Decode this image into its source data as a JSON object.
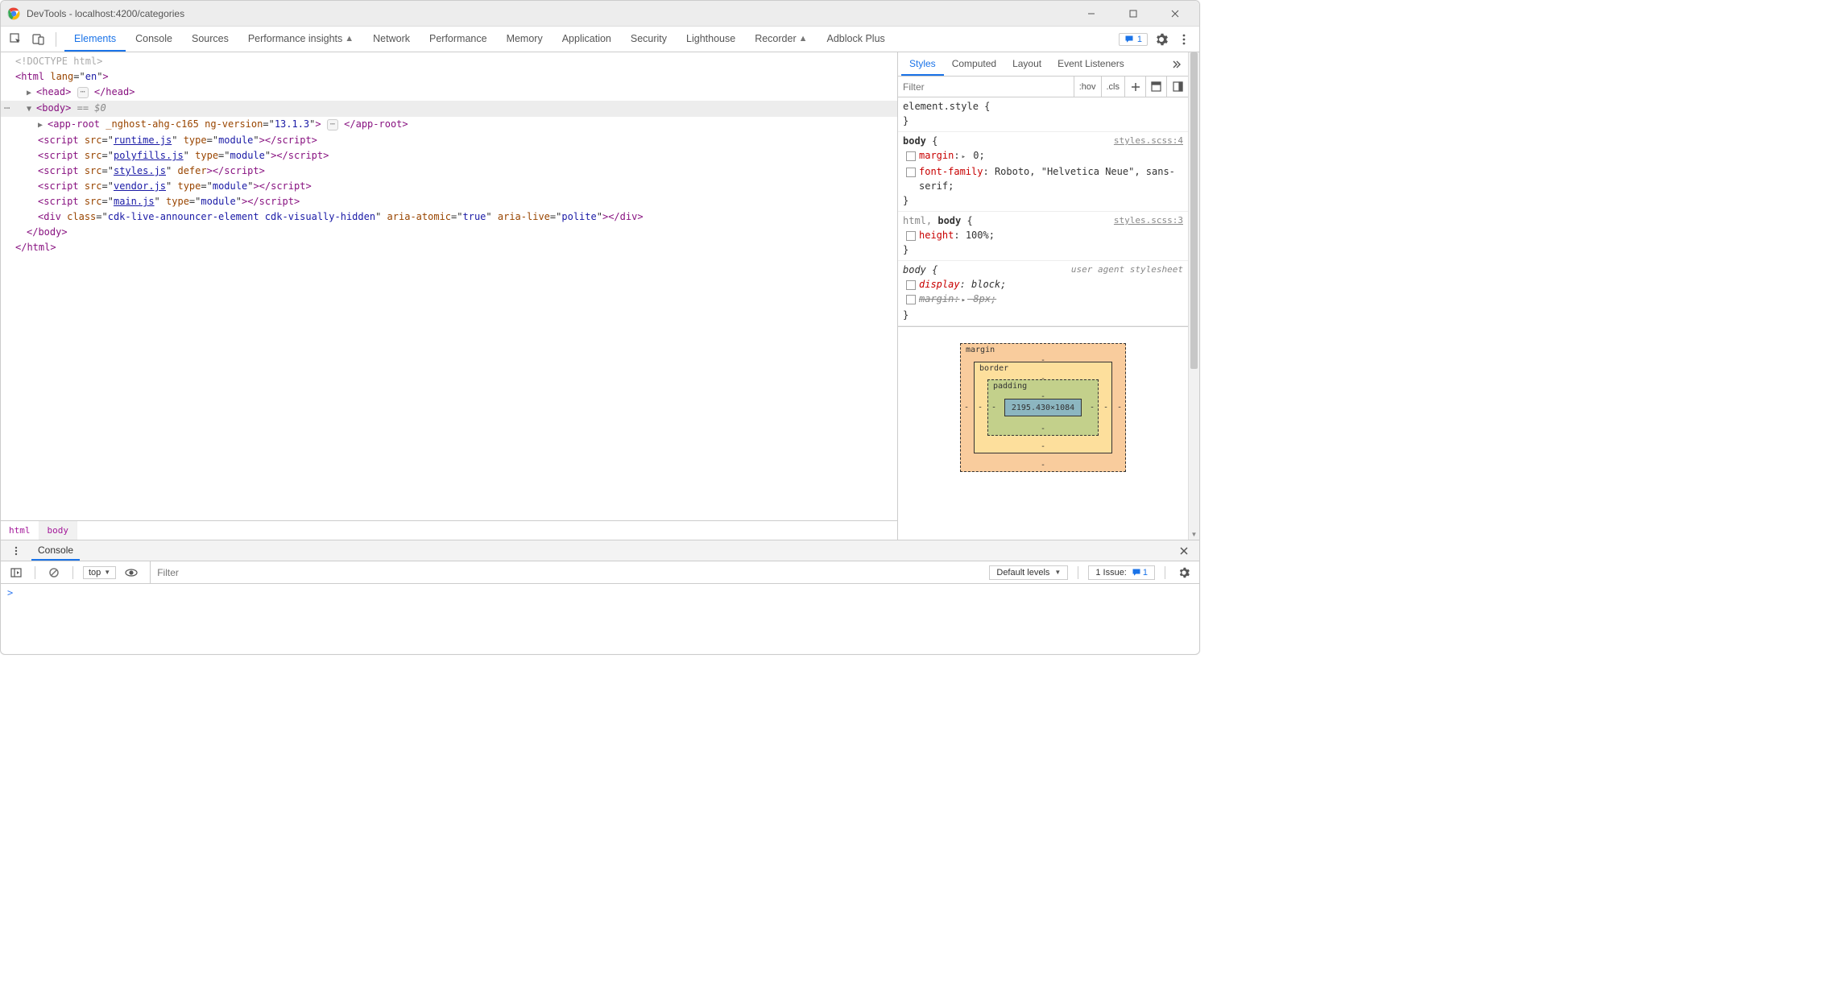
{
  "titlebar": {
    "title": "DevTools - localhost:4200/categories"
  },
  "mainTabs": {
    "items": [
      {
        "label": "Elements",
        "active": true
      },
      {
        "label": "Console"
      },
      {
        "label": "Sources"
      },
      {
        "label": "Performance insights",
        "pin": true
      },
      {
        "label": "Network"
      },
      {
        "label": "Performance"
      },
      {
        "label": "Memory"
      },
      {
        "label": "Application"
      },
      {
        "label": "Security"
      },
      {
        "label": "Lighthouse"
      },
      {
        "label": "Recorder",
        "pin": true
      },
      {
        "label": "Adblock Plus"
      }
    ],
    "issueCount": "1"
  },
  "dom": {
    "doctype": "<!DOCTYPE html>",
    "htmlOpen": {
      "tag": "html",
      "attrs": [
        {
          "n": "lang",
          "v": "en"
        }
      ]
    },
    "head": {
      "tag": "head"
    },
    "body": {
      "tag": "body",
      "selectedSuffix": "== $0"
    },
    "appRoot": {
      "tag": "app-root",
      "attrs": [
        {
          "n": "_nghost-ahg-c165",
          "v": ""
        },
        {
          "n": "ng-version",
          "v": "13.1.3"
        }
      ]
    },
    "scripts": [
      {
        "tag": "script",
        "attrs": [
          {
            "n": "src",
            "v": "runtime.js",
            "link": true
          },
          {
            "n": "type",
            "v": "module"
          }
        ]
      },
      {
        "tag": "script",
        "attrs": [
          {
            "n": "src",
            "v": "polyfills.js",
            "link": true
          },
          {
            "n": "type",
            "v": "module"
          }
        ]
      },
      {
        "tag": "script",
        "attrs": [
          {
            "n": "src",
            "v": "styles.js",
            "link": true
          },
          {
            "n": "defer",
            "v": ""
          }
        ]
      },
      {
        "tag": "script",
        "attrs": [
          {
            "n": "src",
            "v": "vendor.js",
            "link": true
          },
          {
            "n": "type",
            "v": "module"
          }
        ]
      },
      {
        "tag": "script",
        "attrs": [
          {
            "n": "src",
            "v": "main.js",
            "link": true
          },
          {
            "n": "type",
            "v": "module"
          }
        ]
      }
    ],
    "div": {
      "tag": "div",
      "attrs": [
        {
          "n": "class",
          "v": "cdk-live-announcer-element cdk-visually-hidden"
        },
        {
          "n": "aria-atomic",
          "v": "true"
        },
        {
          "n": "aria-live",
          "v": "polite"
        }
      ]
    }
  },
  "breadcrumb": [
    "html",
    "body"
  ],
  "stylesTabs": [
    {
      "label": "Styles",
      "active": true
    },
    {
      "label": "Computed"
    },
    {
      "label": "Layout"
    },
    {
      "label": "Event Listeners"
    }
  ],
  "stylesFilterPlaceholder": "Filter",
  "hovLabel": ":hov",
  "clsLabel": ".cls",
  "rules": [
    {
      "selector": "element.style",
      "origin": "",
      "decls": []
    },
    {
      "selector": "body",
      "origin": "styles.scss:4",
      "decls": [
        {
          "prop": "margin",
          "val": "0",
          "expand": true
        },
        {
          "prop": "font-family",
          "val": "Roboto, \"Helvetica Neue\", sans-serif"
        }
      ]
    },
    {
      "selector_html": "html, ",
      "selector_bold": "body",
      "origin": "styles.scss:3",
      "decls": [
        {
          "prop": "height",
          "val": "100%"
        }
      ]
    },
    {
      "selector": "body",
      "origin": "user agent stylesheet",
      "origin_ua": true,
      "italic": true,
      "decls": [
        {
          "prop": "display",
          "val": "block"
        },
        {
          "prop": "margin",
          "val": "8px",
          "strike": true,
          "expand": true
        }
      ]
    }
  ],
  "boxModel": {
    "marginLabel": "margin",
    "borderLabel": "border",
    "paddingLabel": "padding",
    "content": "2195.430×1084",
    "dash": "-"
  },
  "drawer": {
    "tab": "Console",
    "scope": "top",
    "filterPlaceholder": "Filter",
    "levels": "Default levels",
    "issuesLabel": "1 Issue:",
    "issuesCount": "1",
    "prompt": ">"
  }
}
